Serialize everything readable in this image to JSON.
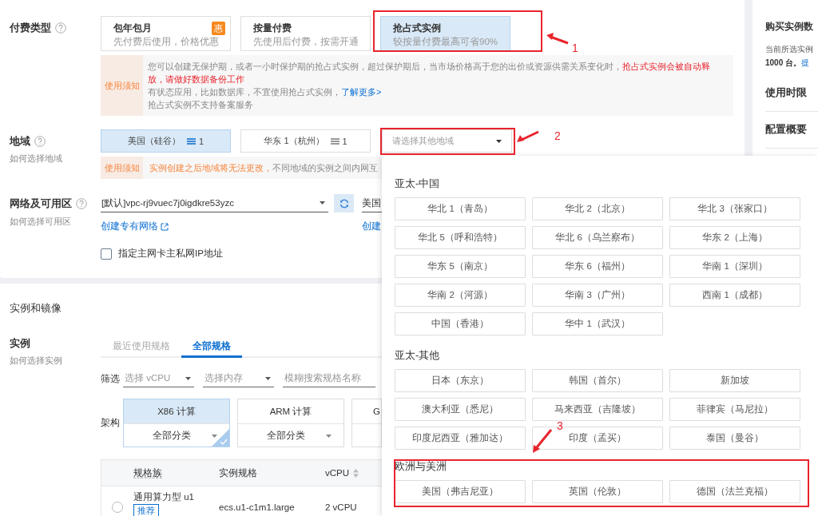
{
  "billing": {
    "label": "付费类型",
    "options": [
      {
        "title": "包年包月",
        "desc": "先付费后使用，价格优惠",
        "badge": "惠",
        "selected": false
      },
      {
        "title": "按量付费",
        "desc": "先使用后付费，按需开通",
        "selected": false
      },
      {
        "title": "抢占式实例",
        "desc": "较按量付费最高可省90%",
        "selected": true
      }
    ],
    "notice": {
      "tag": "使用须知",
      "paragraphs": [
        {
          "segments": [
            {
              "kind": "plain",
              "text": "您可以创建无保护期，或者一小时保护期的抢占式实例，超过保护期后，当市场价格高于您的出价或资源供需关系变化时，"
            },
            {
              "kind": "warning",
              "text": "抢占式实例会被自动释放，请做好数据备份工作"
            }
          ]
        },
        {
          "segments": [
            {
              "kind": "plain",
              "text": "有状态应用，比如数据库，不宜使用抢占式实例，"
            },
            {
              "kind": "link",
              "text": "了解更多>"
            }
          ]
        },
        {
          "segments": [
            {
              "kind": "plain",
              "text": "抢占式实例不支持备案服务"
            }
          ]
        }
      ]
    }
  },
  "region": {
    "label": "地域",
    "help": "如何选择地域",
    "options": [
      {
        "name": "美国（硅谷）",
        "count": "1",
        "selected": true
      },
      {
        "name": "华东 1（杭州）",
        "count": "1",
        "selected": false
      }
    ],
    "other_placeholder": "请选择其他地域",
    "notice": {
      "tag": "使用须知",
      "warning": "实例创建之后地域将无法更改，",
      "text": "不同地域的实例之间内网互"
    }
  },
  "network": {
    "label": "网络及可用区",
    "help": "如何选择可用区",
    "vpc": "[默认]vpc-rj9vuec7j0igdkre53yzc",
    "vpc_link": "创建专有网络",
    "zone": "美国",
    "zone_link": "创建",
    "checkbox": {
      "label": "指定主网卡主私网IP地址",
      "checked": false
    }
  },
  "side": {
    "title": "购买实例数",
    "note": "当前所选实例",
    "quota": "1000 台。",
    "link": "提",
    "sections": [
      "使用时限",
      "配置概要"
    ]
  },
  "instance": {
    "title": "实例和镜像",
    "label": "实例",
    "help": "如何选择实例",
    "tabs": [
      {
        "label": "最近使用规格",
        "selected": false
      },
      {
        "label": "全部规格",
        "selected": true
      }
    ],
    "filter_label": "筛选",
    "filters": [
      "选择 vCPU",
      "选择内存"
    ],
    "search_placeholder": "模糊搜索规格名称",
    "arch_label": "架构",
    "arches": [
      {
        "title": "X86 计算",
        "category": "全部分类",
        "selected": true
      },
      {
        "title": "ARM 计算",
        "category": "全部分类",
        "selected": false
      },
      {
        "title": "G",
        "selected": false
      }
    ],
    "columns": [
      "规格族",
      "实例规格",
      "vCPU"
    ],
    "rows": [
      {
        "family": "通用算力型 u1",
        "badge": "推荐",
        "spec": "ecs.u1-c1m1.large",
        "vcpu": "2 vCPU",
        "selected": false
      }
    ]
  },
  "region_popup": {
    "groups": [
      {
        "title": "亚太-中国",
        "items": [
          "华北 1（青岛）",
          "华北 2（北京）",
          "华北 3（张家口）",
          "华北 5（呼和浩特）",
          "华北 6（乌兰察布）",
          "华东 2（上海）",
          "华东 5（南京）",
          "华东 6（福州）",
          "华南 1（深圳）",
          "华南 2（河源）",
          "华南 3（广州）",
          "西南 1（成都）",
          "中国（香港）",
          "华中 1（武汉）"
        ]
      },
      {
        "title": "亚太-其他",
        "items": [
          "日本（东京）",
          "韩国（首尔）",
          "新加坡",
          "澳大利亚（悉尼）",
          "马来西亚（吉隆坡）",
          "菲律宾（马尼拉）",
          "印度尼西亚（雅加达）",
          "印度（孟买）",
          "泰国（曼谷）"
        ]
      },
      {
        "title": "欧洲与美洲",
        "items": [
          "美国（弗吉尼亚）",
          "英国（伦敦）",
          "德国（法兰克福）"
        ]
      }
    ]
  },
  "annotations": [
    {
      "number": "1"
    },
    {
      "number": "2"
    },
    {
      "number": "3"
    }
  ]
}
